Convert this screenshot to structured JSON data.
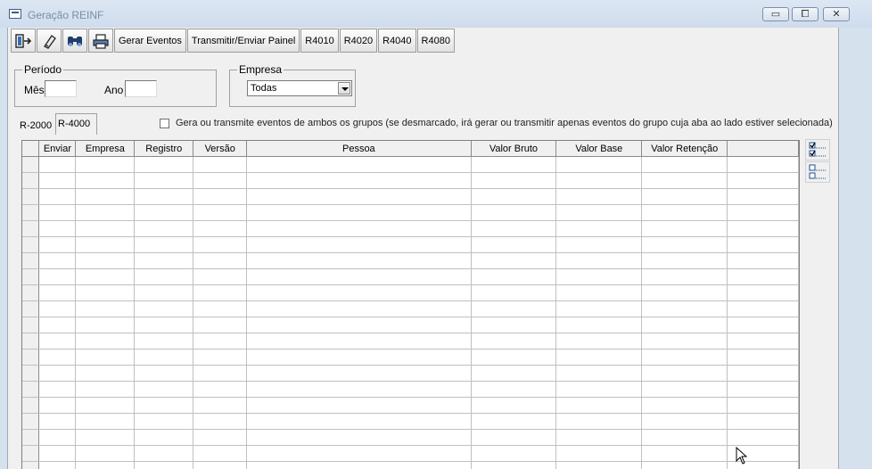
{
  "window": {
    "title": "Geração REINF",
    "minimize_label": "▭",
    "maximize_label": "⧠",
    "close_label": "✕"
  },
  "toolbar": {
    "icons": [
      "exit-icon",
      "eraser-icon",
      "binoculars-icon",
      "printer-icon"
    ],
    "buttons": [
      "Gerar Eventos",
      "Transmitir/Enviar Painel",
      "R4010",
      "R4020",
      "R4040",
      "R4080"
    ]
  },
  "periodo": {
    "legend": "Período",
    "mes_label": "Mês",
    "mes_value": "",
    "ano_label": "Ano",
    "ano_value": ""
  },
  "empresa": {
    "legend": "Empresa",
    "selected": "Todas"
  },
  "tabs": [
    {
      "label": "R-2000",
      "active": false
    },
    {
      "label": "R-4000",
      "active": true
    }
  ],
  "checkbox": {
    "checked": false,
    "label": "Gera ou transmite eventos de ambos os grupos (se desmarcado, irá gerar ou transmitir apenas eventos do grupo cuja aba ao lado estiver selecionada)"
  },
  "grid": {
    "columns": [
      "Enviar",
      "Empresa",
      "Registro",
      "Versão",
      "Pessoa",
      "Valor Bruto",
      "Valor Base",
      "Valor Retenção"
    ],
    "rows": []
  },
  "side_tools": [
    "check-all-icon",
    "uncheck-all-icon"
  ]
}
